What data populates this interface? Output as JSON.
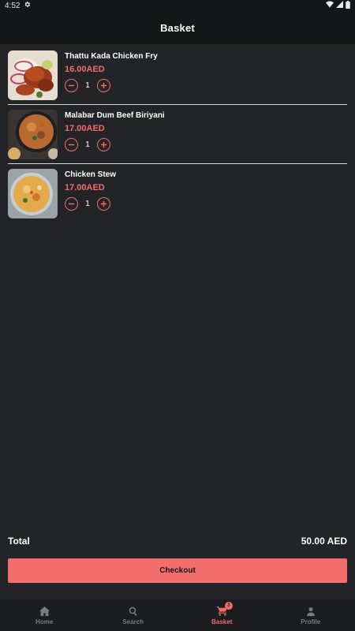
{
  "status_bar": {
    "time": "4:52"
  },
  "header": {
    "title": "Basket"
  },
  "items": [
    {
      "name": "Thattu Kada Chicken Fry",
      "price": "16.00AED",
      "quantity": "1"
    },
    {
      "name": "Malabar Dum Beef Biriyani",
      "price": "17.00AED",
      "quantity": "1"
    },
    {
      "name": "Chicken Stew",
      "price": "17.00AED",
      "quantity": "1"
    }
  ],
  "summary": {
    "total_label": "Total",
    "total_value": "50.00 AED"
  },
  "checkout_label": "Checkout",
  "nav": {
    "items": [
      {
        "label": "Home",
        "icon": "home-icon"
      },
      {
        "label": "Search",
        "icon": "search-icon"
      },
      {
        "label": "Basket",
        "icon": "cart-icon",
        "badge": "3"
      },
      {
        "label": "Profile",
        "icon": "person-icon"
      }
    ],
    "active": "Basket"
  },
  "colors": {
    "accent": "#f26c6c",
    "background": "#232427",
    "bar": "#151618"
  }
}
